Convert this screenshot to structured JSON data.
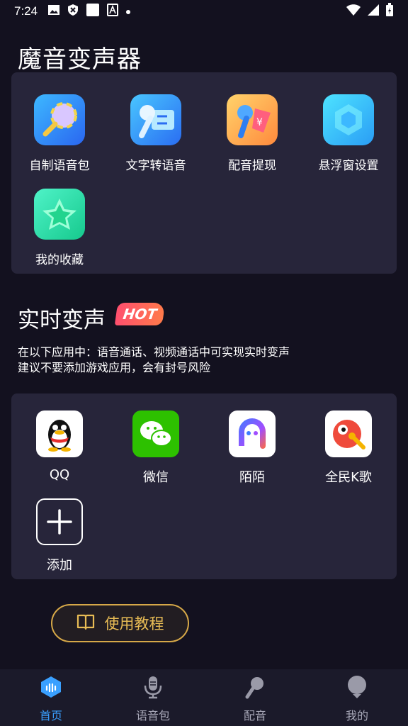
{
  "status_bar": {
    "time": "7:24",
    "icons": [
      "image-icon",
      "shield-x-icon",
      "square-icon",
      "font-icon",
      "dot-icon"
    ],
    "right_icons": [
      "wifi-icon",
      "signal-icon",
      "battery-icon"
    ]
  },
  "page_title": "魔音变声器",
  "tools": [
    {
      "label": "自制语音包",
      "icon": "lollipop-mic-icon"
    },
    {
      "label": "文字转语音",
      "icon": "mic-convert-icon"
    },
    {
      "label": "配音提现",
      "icon": "mic-money-icon"
    },
    {
      "label": "悬浮窗设置",
      "icon": "hexagon-icon"
    },
    {
      "label": "我的收藏",
      "icon": "star-icon"
    }
  ],
  "realtime": {
    "title": "实时变声",
    "badge": "HOT",
    "desc_line1": "在以下应用中：语音通话、视频通话中可实现实时变声",
    "desc_line2": "建议不要添加游戏应用，会有封号风险"
  },
  "apps": [
    {
      "label": "QQ",
      "icon": "qq-penguin-icon"
    },
    {
      "label": "微信",
      "icon": "wechat-icon"
    },
    {
      "label": "陌陌",
      "icon": "momo-icon"
    },
    {
      "label": "全民K歌",
      "icon": "kge-icon"
    },
    {
      "label": "添加",
      "icon": "add-icon"
    }
  ],
  "guide_button": {
    "label": "使用教程",
    "icon": "book-icon"
  },
  "tabs": [
    {
      "label": "首页",
      "icon": "home-icon",
      "active": true
    },
    {
      "label": "语音包",
      "icon": "voice-pack-icon",
      "active": false
    },
    {
      "label": "配音",
      "icon": "dubbing-mic-icon",
      "active": false
    },
    {
      "label": "我的",
      "icon": "profile-icon",
      "active": false
    }
  ],
  "colors": {
    "accent": "#3aa0ff",
    "gold": "#d6a848",
    "hot": "#ff5470"
  }
}
